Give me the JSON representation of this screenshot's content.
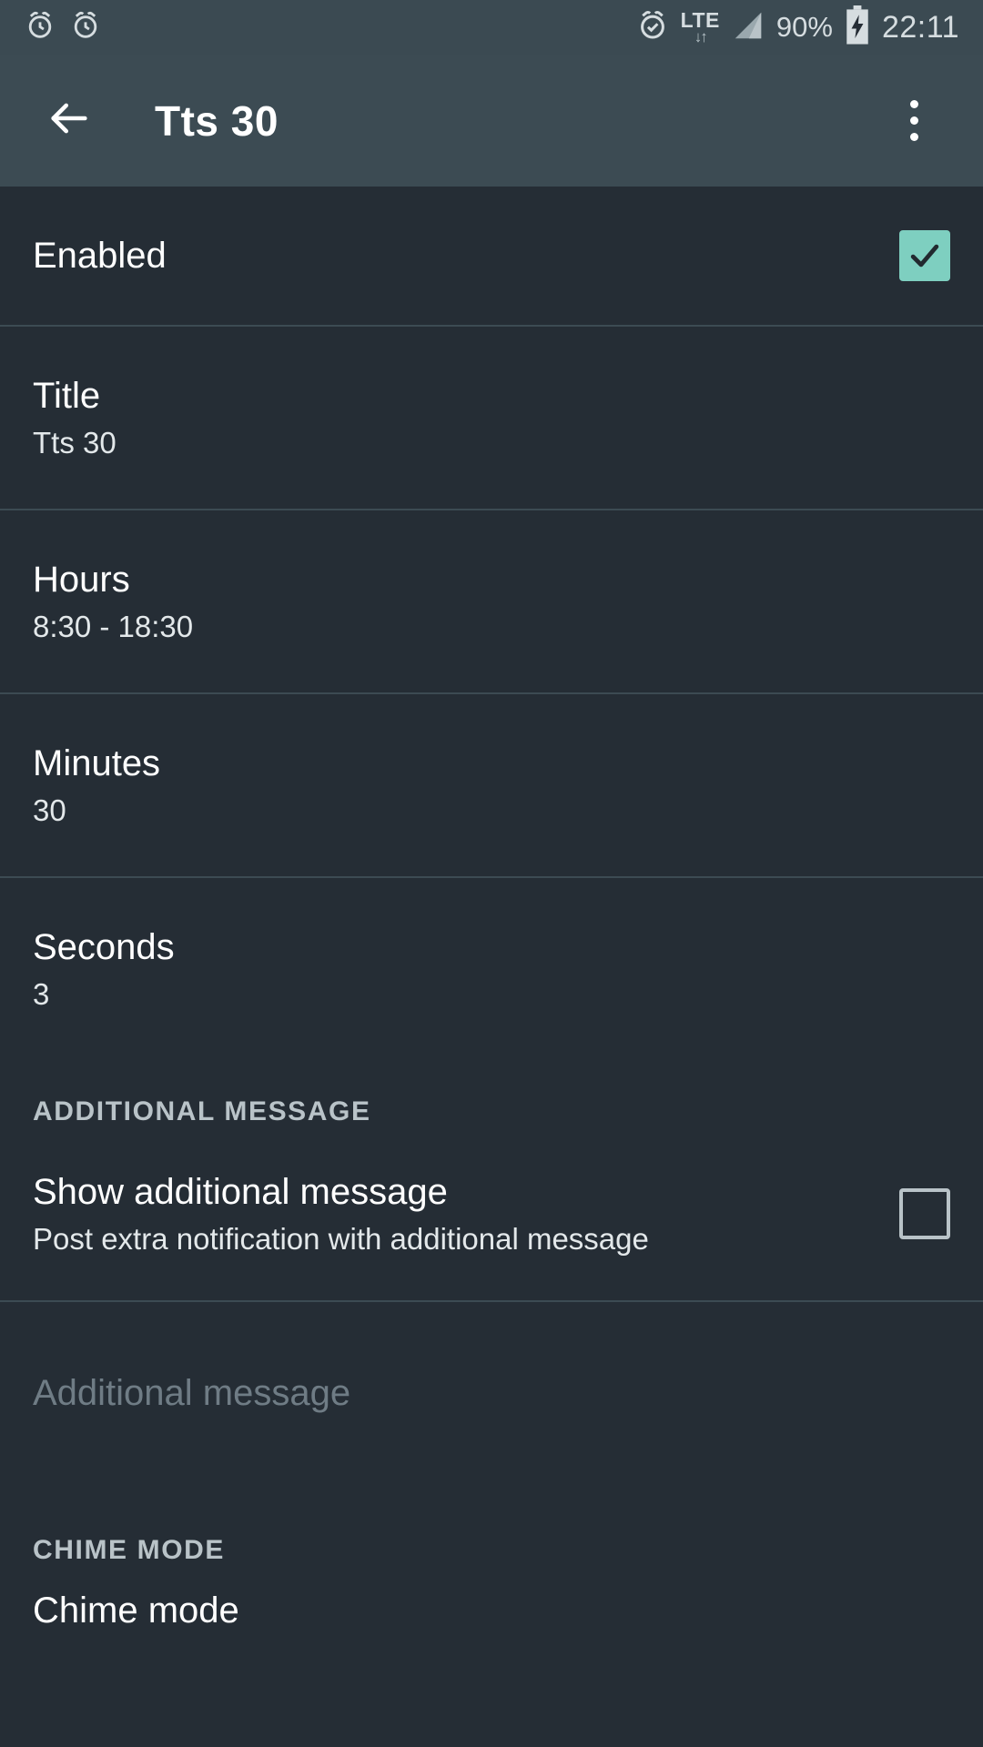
{
  "status_bar": {
    "left_icons": [
      "alarm-clock-icon",
      "alarm-clock-icon"
    ],
    "alarm_icon": "alarm-check-icon",
    "network_type": "LTE",
    "data_arrows": "↓↑",
    "battery_percent": "90%",
    "battery_state": "charging",
    "time": "22:11"
  },
  "app_bar": {
    "back_icon": "arrow-left-icon",
    "title": "Tts 30",
    "overflow_icon": "more-vertical-icon"
  },
  "preferences": [
    {
      "key": "enabled",
      "title": "Enabled",
      "summary": "",
      "control": "checkbox",
      "checked": true
    },
    {
      "key": "title",
      "title": "Title",
      "summary": "Tts 30",
      "control": "none"
    },
    {
      "key": "hours",
      "title": "Hours",
      "summary": "8:30 - 18:30",
      "control": "none"
    },
    {
      "key": "minutes",
      "title": "Minutes",
      "summary": "30",
      "control": "none"
    },
    {
      "key": "seconds",
      "title": "Seconds",
      "summary": "3",
      "control": "none"
    }
  ],
  "additional_message_section": {
    "header": "ADDITIONAL MESSAGE",
    "show_message": {
      "title": "Show additional message",
      "summary": "Post extra notification with additional message",
      "checked": false
    },
    "additional_message_field": {
      "title": "Additional message",
      "disabled": true
    }
  },
  "chime_mode_section": {
    "header": "CHIME MODE",
    "item": {
      "title": "Chime mode"
    }
  },
  "colors": {
    "status_bar_bg": "#3b4a52",
    "app_bar_bg": "#3c4b53",
    "content_bg": "#252d35",
    "accent_checkbox": "#7ecfc0",
    "divider": "#3c4b53",
    "text_primary": "#ffffff",
    "text_secondary": "#e3e8ea",
    "text_header": "#b9c3c8",
    "text_disabled": "#6f7c85"
  }
}
